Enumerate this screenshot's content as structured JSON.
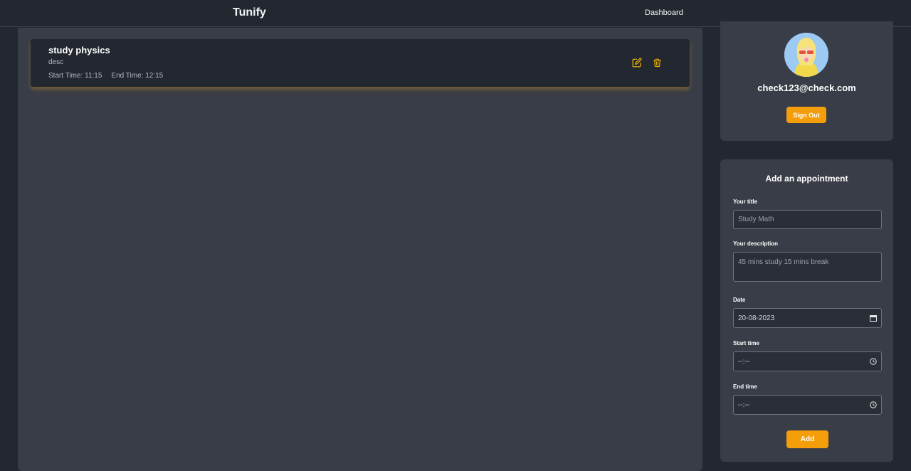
{
  "nav": {
    "brand": "Tunify",
    "dashboard_link": "Dashboard"
  },
  "appointments": [
    {
      "title": "study physics",
      "description": "desc",
      "start_label": "Start Time: 11:15",
      "end_label": "End Time: 12:15"
    }
  ],
  "icons": {
    "edit": "edit-icon",
    "delete": "trash-icon",
    "calendar": "calendar-icon",
    "clock": "clock-icon"
  },
  "profile": {
    "email": "check123@check.com",
    "sign_out_label": "Sign Out"
  },
  "form": {
    "title": "Add an appointment",
    "title_label": "Your title",
    "title_placeholder": "Study Math",
    "description_label": "Your description",
    "description_placeholder": "45 mins study 15 mins break",
    "date_label": "Date",
    "date_value": "20-08-2023",
    "start_label": "Start time",
    "start_value": "--:--",
    "end_label": "End time",
    "end_value": "--:--",
    "submit_label": "Add"
  },
  "colors": {
    "accent": "#f59e0b",
    "background": "#222730",
    "panel": "#393d47"
  }
}
